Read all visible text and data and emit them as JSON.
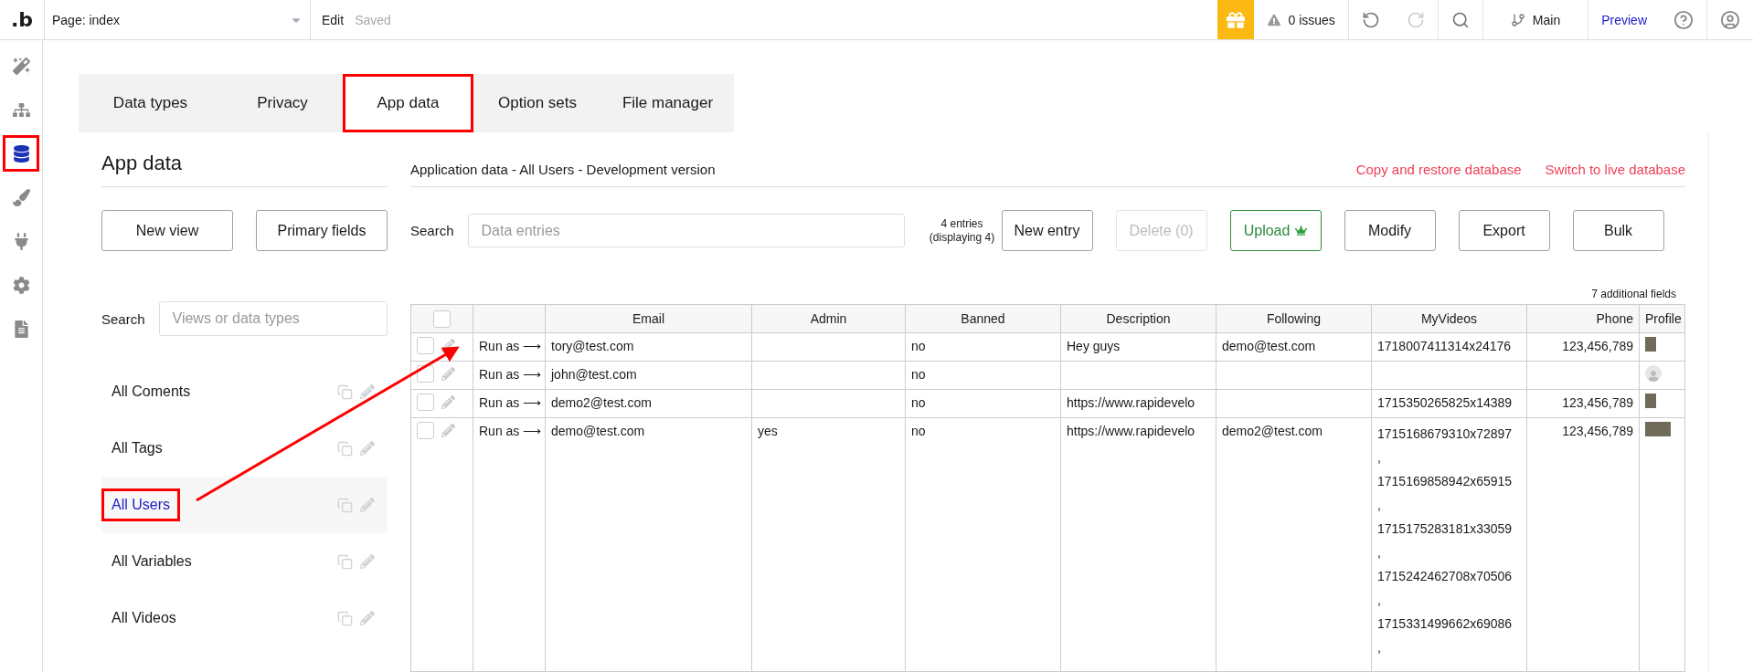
{
  "topbar": {
    "logo": ".b",
    "page_selector": "Page: index",
    "edit": "Edit",
    "saved": "Saved",
    "issues": "0 issues",
    "branch": "Main",
    "preview": "Preview"
  },
  "rail": [
    {
      "kind": "design",
      "selected": false,
      "highlighted": false
    },
    {
      "kind": "workflow",
      "selected": false,
      "highlighted": false
    },
    {
      "kind": "data",
      "selected": true,
      "highlighted": true
    },
    {
      "kind": "styles",
      "selected": false,
      "highlighted": false
    },
    {
      "kind": "plugins",
      "selected": false,
      "highlighted": false
    },
    {
      "kind": "settings",
      "selected": false,
      "highlighted": false
    },
    {
      "kind": "logs",
      "selected": false,
      "highlighted": false
    }
  ],
  "tabs": [
    {
      "label": "Data types",
      "selected": false,
      "highlighted": false
    },
    {
      "label": "Privacy",
      "selected": false,
      "highlighted": false
    },
    {
      "label": "App data",
      "selected": true,
      "highlighted": true
    },
    {
      "label": "Option sets",
      "selected": false,
      "highlighted": false
    },
    {
      "label": "File manager",
      "selected": false,
      "highlighted": false
    }
  ],
  "views_panel": {
    "title": "App data",
    "buttons": [
      "New view",
      "Primary fields"
    ],
    "search_label": "Search",
    "search_placeholder": "Views or data types",
    "items": [
      {
        "label": "All Coments",
        "selected": false,
        "highlighted": false
      },
      {
        "label": "All Tags",
        "selected": false,
        "highlighted": false
      },
      {
        "label": "All Users",
        "selected": true,
        "highlighted": true
      },
      {
        "label": "All Variables",
        "selected": false,
        "highlighted": false
      },
      {
        "label": "All Videos",
        "selected": false,
        "highlighted": false
      }
    ]
  },
  "data_panel": {
    "title": "Application data - All Users - Development version",
    "links": [
      "Copy and restore database",
      "Switch to live database"
    ],
    "search_label": "Search",
    "search_placeholder": "Data entries",
    "entries_count": "4 entries (displaying 4)",
    "buttons": [
      {
        "label": "New entry",
        "kind": "plain",
        "disabled": false
      },
      {
        "label": "Delete (0)",
        "kind": "plain",
        "disabled": true
      },
      {
        "label": "Upload",
        "kind": "upload",
        "disabled": false
      },
      {
        "label": "Modify",
        "kind": "plain",
        "disabled": false
      },
      {
        "label": "Export",
        "kind": "plain",
        "disabled": false
      },
      {
        "label": "Bulk",
        "kind": "plain",
        "disabled": false
      }
    ],
    "additional_fields": "7 additional fields",
    "table": {
      "select_all_checked": false,
      "columns": [
        {
          "label": "Email",
          "numeric": false
        },
        {
          "label": "Admin",
          "numeric": false
        },
        {
          "label": "Banned",
          "numeric": false
        },
        {
          "label": "Description",
          "numeric": false
        },
        {
          "label": "Following",
          "numeric": false
        },
        {
          "label": "MyVideos",
          "numeric": false
        },
        {
          "label": "Phone",
          "numeric": true
        },
        {
          "label": "Profile"
        }
      ],
      "rows": [
        {
          "checked": false,
          "run_as": "Run as ⟶",
          "cells": [
            "tory@test.com",
            null,
            "no",
            "Hey guys",
            "demo@test.com",
            [
              "1718007411314x24176"
            ],
            "123,456,789"
          ],
          "photo": true
        },
        {
          "checked": false,
          "run_as": "Run as ⟶",
          "cells": [
            "john@test.com",
            null,
            "no",
            null,
            null,
            null,
            null
          ],
          "photo": false
        },
        {
          "checked": false,
          "run_as": "Run as ⟶",
          "cells": [
            "demo2@test.com",
            null,
            "no",
            "https://www.rapidevelo",
            null,
            [
              "1715350265825x14389"
            ],
            "123,456,789"
          ],
          "photo": true
        },
        {
          "checked": false,
          "run_as": "Run as ⟶",
          "cells": [
            "demo@test.com",
            "yes",
            "no",
            "https://www.rapidevelo",
            "demo2@test.com",
            [
              "1715168679310x72897",
              ",",
              "1715169858942x65915",
              ",",
              "1715175283181x33059",
              ",",
              "1715242462708x70506",
              ",",
              "1715331499662x69086",
              ","
            ],
            "123,456,789"
          ],
          "photo": true
        }
      ]
    }
  }
}
